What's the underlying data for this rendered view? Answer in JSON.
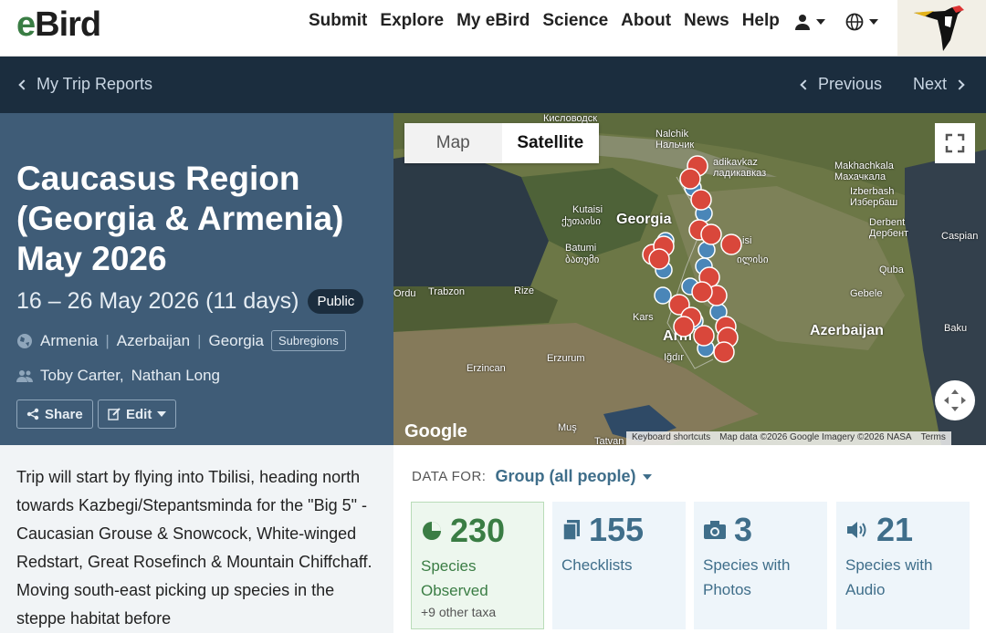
{
  "brand": {
    "logo_e": "e",
    "logo_rest": "Bird"
  },
  "nav": {
    "links": [
      "Submit",
      "Explore",
      "My eBird",
      "Science",
      "About",
      "News",
      "Help"
    ],
    "icons": {
      "account": "user-icon",
      "language": "globe-icon"
    }
  },
  "subnav": {
    "back": "My Trip Reports",
    "previous": "Previous",
    "next": "Next"
  },
  "trip": {
    "title": "Caucasus Region (Georgia & Armenia) May 2026",
    "dates": "16 – 26 May 2026 (11 days)",
    "visibility": "Public",
    "regions": [
      "Armenia",
      "Azerbaijan",
      "Georgia"
    ],
    "subregions_label": "Subregions",
    "people": [
      "Toby Carter,",
      "Nathan Long"
    ],
    "share_label": "Share",
    "edit_label": "Edit"
  },
  "map": {
    "toggle": {
      "map": "Map",
      "satellite": "Satellite"
    },
    "logo": "Google",
    "attribution": [
      "Keyboard shortcuts",
      "Map data ©2026 Google Imagery ©2026 NASA",
      "Terms"
    ],
    "labels": {
      "kislovodsk": "Кисловодск",
      "nalchik": "Nalchik",
      "nalchik_ru": "Нальчик",
      "vladikavkaz": "adikavkaz",
      "vladikavkaz_ru": "ладикавказ",
      "makhachkala": "Makhachkala",
      "makhachkala_ru": "Махачкала",
      "izberbash": "Izberbash",
      "izberbash_ru": "Избербаш",
      "kutaisi": "Kutaisi",
      "kutaisi_ka": "ქუთაისი",
      "georgia": "Georgia",
      "derbent": "Derbent",
      "derbent_ru": "Дербент",
      "caspian": "Caspian",
      "batumi": "Batumi",
      "batumi_ka": "ბათუმი",
      "tbilisi": "isi",
      "tbilisi_ka": "ილისი",
      "quba": "Quba",
      "ordu": "Ordu",
      "trabzon": "Trabzon",
      "rize": "Rize",
      "gebele": "Gebele",
      "kars": "Kars",
      "azerbaijan": "Azerbaijan",
      "baku": "Baku",
      "armenia": "Arm",
      "igdir": "Iğdır",
      "erzincan": "Erzincan",
      "erzurum": "Erzurum",
      "mus": "Muş",
      "tatvan": "Tatvan"
    }
  },
  "description": "Trip will start by flying into Tbilisi, heading north towards Kazbegi/Stepantsminda for the \"Big 5\" - Caucasian Grouse & Snowcock, White-winged Redstart, Great Rosefinch & Mountain Chiffchaff. Moving south-east picking up species in the steppe habitat before",
  "data_for": {
    "label": "DATA FOR:",
    "value": "Group (all people)"
  },
  "stats": [
    {
      "value": "230",
      "label": "Species Observed",
      "sub": "+9 other taxa",
      "icon": "species-icon"
    },
    {
      "value": "155",
      "label": "Checklists",
      "icon": "checklist-icon"
    },
    {
      "value": "3",
      "label": "Species with Photos",
      "icon": "camera-icon"
    },
    {
      "value": "21",
      "label": "Species with Audio",
      "icon": "speaker-icon"
    }
  ],
  "colors": {
    "green": "#3a7d44",
    "blue": "#3f6e8a",
    "hero": "#3f5c77",
    "subnav": "#1b2d3e",
    "marker_red": "#d9473b",
    "marker_blue": "#4a86b8"
  }
}
